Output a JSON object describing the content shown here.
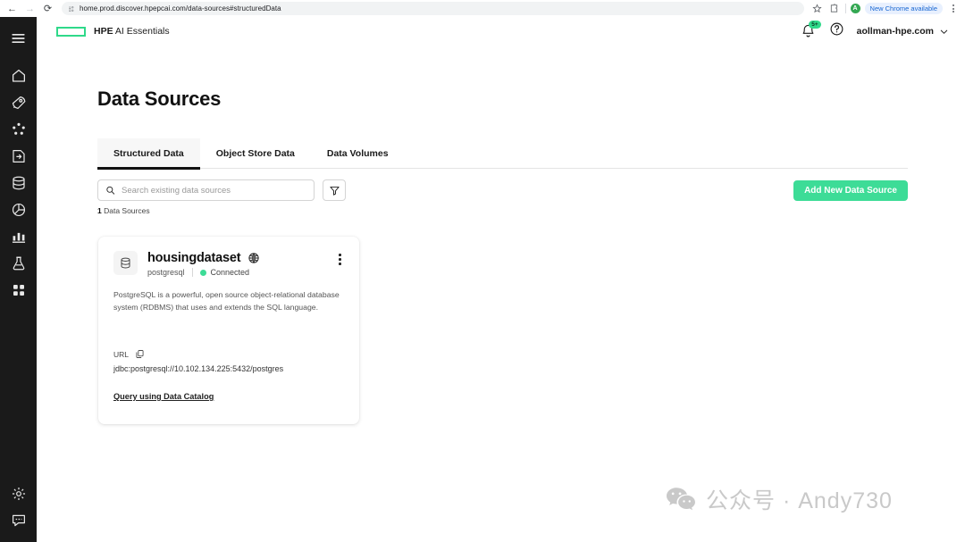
{
  "browser": {
    "back_icon": "back-arrow-icon",
    "forward_icon": "forward-arrow-icon",
    "reload_icon": "reload-icon",
    "url": "home.prod.discover.hpepcai.com/data-sources#structuredData",
    "bookmark_icon": "star-icon",
    "extensions_icon": "puzzle-icon",
    "profile_initial": "A",
    "update_pill": "New Chrome available",
    "menu_icon": "kebab-menu-icon"
  },
  "rail": {
    "menu_label": "hamburger-menu",
    "items": [
      {
        "name": "home",
        "label": "Home"
      },
      {
        "name": "getting-started",
        "label": "Getting Started"
      },
      {
        "name": "clusters",
        "label": "Clusters"
      },
      {
        "name": "applications",
        "label": "Applications"
      },
      {
        "name": "data-sources",
        "label": "Data Sources"
      },
      {
        "name": "dashboards",
        "label": "Dashboards"
      },
      {
        "name": "analytics",
        "label": "Analytics"
      },
      {
        "name": "experiments",
        "label": "Experiments"
      },
      {
        "name": "tools",
        "label": "Tools"
      }
    ],
    "bottom_items": [
      {
        "name": "settings",
        "label": "Settings"
      },
      {
        "name": "feedback",
        "label": "Feedback"
      }
    ]
  },
  "header": {
    "logo_name": "hpe-logo",
    "brand_bold": "HPE",
    "brand_rest": " AI Essentials",
    "notification_badge": "5+",
    "notification_icon": "bell-icon",
    "help_icon": "help-circle-icon",
    "account": "aollman-hpe.com",
    "chevron_icon": "chevron-down-icon"
  },
  "page": {
    "title": "Data Sources",
    "tabs": [
      {
        "label": "Structured Data",
        "active": true
      },
      {
        "label": "Object Store Data",
        "active": false
      },
      {
        "label": "Data Volumes",
        "active": false
      }
    ],
    "search": {
      "placeholder": "Search existing data sources",
      "value": "",
      "icon": "search-icon"
    },
    "filter_icon": "filter-icon",
    "add_button": "Add New Data Source",
    "count_number": "1",
    "count_label": " Data Sources"
  },
  "card": {
    "icon": "database-icon",
    "title": "housingdataset",
    "globe_icon": "globe-icon",
    "menu_icon": "kebab-menu-icon",
    "type": "postgresql",
    "status": "Connected",
    "status_color": "#3ddc97",
    "description": "PostgreSQL is a powerful, open source object-relational database system (RDBMS) that uses and extends the SQL language.",
    "url_label": "URL",
    "copy_icon": "copy-icon",
    "url_value": "jdbc:postgresql://10.102.134.225:5432/postgres",
    "link": "Query using Data Catalog"
  },
  "watermark": {
    "icon": "wechat-icon",
    "text": "公众号 · Andy730"
  },
  "colors": {
    "accent_green": "#3ddc97",
    "hpe_green": "#2fd98a",
    "rail_bg": "#1a1a1a",
    "text_primary": "#111111"
  }
}
